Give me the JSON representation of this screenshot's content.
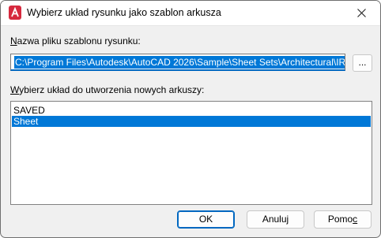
{
  "window": {
    "title": "Wybierz układ rysunku jako szablon arkusza",
    "icon": "autocad-app-icon",
    "close_icon": "close-icon"
  },
  "template_file": {
    "label_prefix": "N",
    "label_rest": "azwa pliku szablonu rysunku:",
    "value": "C:\\Program Files\\Autodesk\\AutoCAD 2026\\Sample\\Sheet Sets\\Architectural\\IRD.dwt",
    "browse_label": "..."
  },
  "layouts": {
    "label_prefix": "W",
    "label_rest": "ybierz układ do utworzenia nowych arkuszy:",
    "items": [
      {
        "label": "SAVED",
        "selected": false
      },
      {
        "label": "Sheet",
        "selected": true
      }
    ]
  },
  "buttons": {
    "ok": "OK",
    "cancel": "Anuluj",
    "help_prefix": "Pomo",
    "help_underline": "c"
  },
  "colors": {
    "selection": "#0078d7",
    "accent": "#0067c0",
    "app_icon": "#d6293e"
  }
}
